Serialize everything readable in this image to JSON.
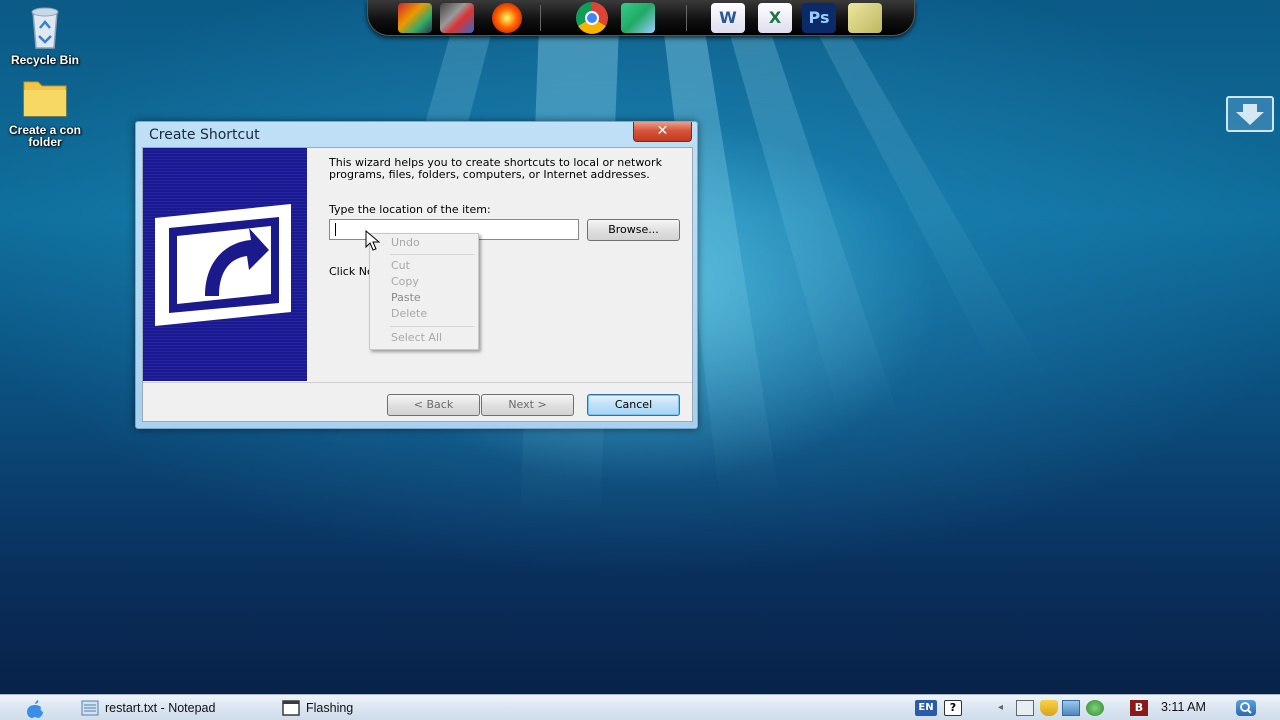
{
  "desktop": {
    "icons": [
      {
        "label": "Recycle Bin",
        "icon": "recycle-bin-icon"
      },
      {
        "label": "Create a con folder",
        "icon": "folder-icon"
      }
    ]
  },
  "dock": {
    "items": [
      "games-icon",
      "control-panel-icon",
      "burner-icon",
      "chrome-icon",
      "network-sync-icon",
      "word-icon",
      "excel-icon",
      "photoshop-icon",
      "notes-icon"
    ]
  },
  "dialog": {
    "title": "Create Shortcut",
    "close_label": "✕",
    "intro": "This wizard helps you to create shortcuts to local or network programs, files, folders, computers, or Internet addresses.",
    "location_label": "Type the location of the item:",
    "location_value": "",
    "continue_text": "Click Next to continue.",
    "browse_label": "Browse...",
    "back_label": "< Back",
    "next_label": "Next >",
    "cancel_label": "Cancel"
  },
  "context_menu": {
    "items": [
      "Undo",
      "Cut",
      "Copy",
      "Paste",
      "Delete",
      "Select All"
    ]
  },
  "taskbar": {
    "tasks": [
      {
        "label": "restart.txt - Notepad",
        "icon": "notepad-icon"
      },
      {
        "label": "Flashing",
        "icon": "window-icon"
      }
    ],
    "language": "EN",
    "clock": "3:11 AM"
  },
  "colors": {
    "desktop_top": "#0c5a86",
    "desktop_bottom": "#081f44",
    "banner": "#1a1a8c",
    "close_button": "#d6553a"
  }
}
